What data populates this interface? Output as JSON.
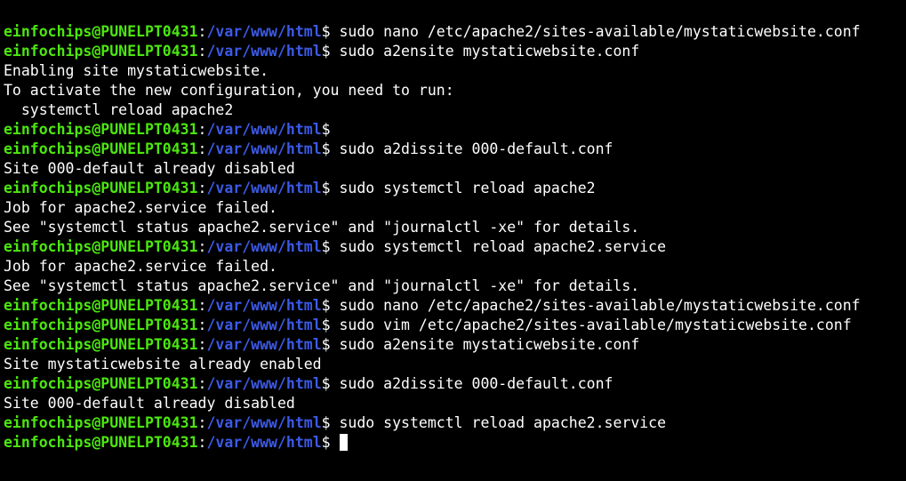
{
  "colors": {
    "background": "#000000",
    "user_host": "#4ce60f",
    "path": "#3c5ae6",
    "text": "#ffffff"
  },
  "prompt": {
    "user_host": "einfochips@PUNELPT0431",
    "path": "/var/www/html"
  },
  "lines": [
    {
      "type": "prompt",
      "user_host": "einfochips@PUNELPT0431",
      "path": "/var/www/html",
      "command": " sudo nano /etc/apache2/sites-available/mystaticwebsite.conf"
    },
    {
      "type": "prompt",
      "user_host": "einfochips@PUNELPT0431",
      "path": "/var/www/html",
      "command": " sudo a2ensite mystaticwebsite.conf"
    },
    {
      "type": "output",
      "text": "Enabling site mystaticwebsite."
    },
    {
      "type": "output",
      "text": "To activate the new configuration, you need to run:"
    },
    {
      "type": "output",
      "text": "  systemctl reload apache2"
    },
    {
      "type": "prompt",
      "user_host": "einfochips@PUNELPT0431",
      "path": "/var/www/html",
      "command": ""
    },
    {
      "type": "prompt",
      "user_host": "einfochips@PUNELPT0431",
      "path": "/var/www/html",
      "command": " sudo a2dissite 000-default.conf"
    },
    {
      "type": "output",
      "text": "Site 000-default already disabled"
    },
    {
      "type": "prompt",
      "user_host": "einfochips@PUNELPT0431",
      "path": "/var/www/html",
      "command": " sudo systemctl reload apache2"
    },
    {
      "type": "output",
      "text": "Job for apache2.service failed."
    },
    {
      "type": "output",
      "text": "See \"systemctl status apache2.service\" and \"journalctl -xe\" for details."
    },
    {
      "type": "prompt",
      "user_host": "einfochips@PUNELPT0431",
      "path": "/var/www/html",
      "command": " sudo systemctl reload apache2.service"
    },
    {
      "type": "output",
      "text": "Job for apache2.service failed."
    },
    {
      "type": "output",
      "text": "See \"systemctl status apache2.service\" and \"journalctl -xe\" for details."
    },
    {
      "type": "prompt",
      "user_host": "einfochips@PUNELPT0431",
      "path": "/var/www/html",
      "command": " sudo nano /etc/apache2/sites-available/mystaticwebsite.conf"
    },
    {
      "type": "prompt",
      "user_host": "einfochips@PUNELPT0431",
      "path": "/var/www/html",
      "command": " sudo vim /etc/apache2/sites-available/mystaticwebsite.conf"
    },
    {
      "type": "prompt",
      "user_host": "einfochips@PUNELPT0431",
      "path": "/var/www/html",
      "command": " sudo a2ensite mystaticwebsite.conf"
    },
    {
      "type": "output",
      "text": "Site mystaticwebsite already enabled"
    },
    {
      "type": "prompt",
      "user_host": "einfochips@PUNELPT0431",
      "path": "/var/www/html",
      "command": " sudo a2dissite 000-default.conf"
    },
    {
      "type": "output",
      "text": "Site 000-default already disabled"
    },
    {
      "type": "prompt",
      "user_host": "einfochips@PUNELPT0431",
      "path": "/var/www/html",
      "command": " sudo systemctl reload apache2.service"
    },
    {
      "type": "prompt_active",
      "user_host": "einfochips@PUNELPT0431",
      "path": "/var/www/html",
      "command": " "
    }
  ]
}
